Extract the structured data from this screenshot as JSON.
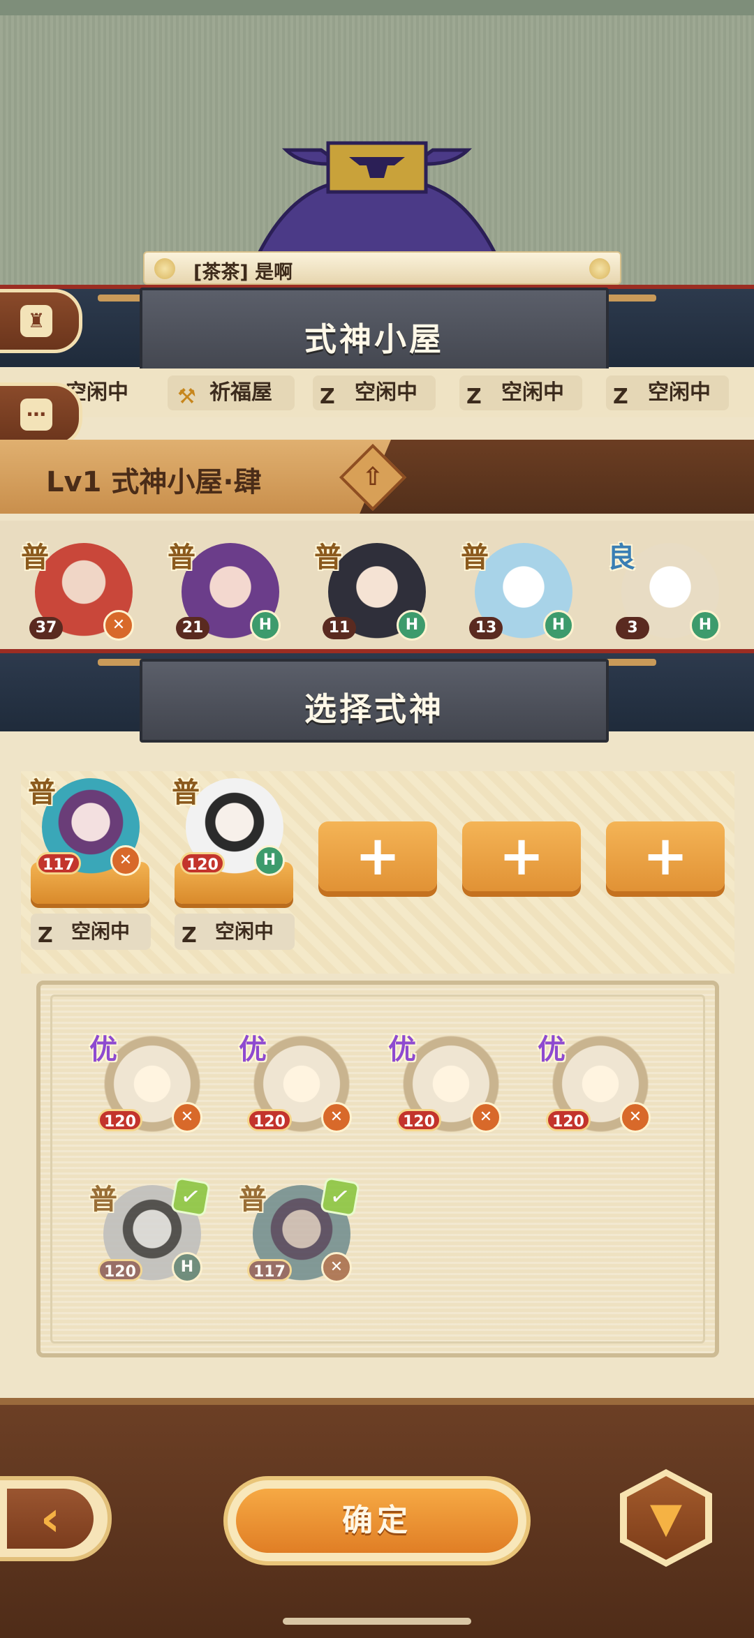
{
  "chat": {
    "speaker": "[茶茶]",
    "message": "是啊"
  },
  "house_title": "式神小屋",
  "status_row": [
    {
      "label": "空闲中",
      "icon": "zz-sleep-icon"
    },
    {
      "label": "祈福屋",
      "icon": "hammer-icon"
    },
    {
      "label": "空闲中",
      "icon": "zz-sleep-icon"
    },
    {
      "label": "空闲中",
      "icon": "zz-sleep-icon"
    },
    {
      "label": "空闲中",
      "icon": "zz-sleep-icon"
    }
  ],
  "level": {
    "text": "Lv1 式神小屋·肆",
    "upgrade_icon": "upgrade-arrow-icon"
  },
  "roster": [
    {
      "grade": "普",
      "level": "37",
      "role": "attack",
      "color": "#c9473a"
    },
    {
      "grade": "普",
      "level": "21",
      "role": "support",
      "color": "#6b3d8a"
    },
    {
      "grade": "普",
      "level": "11",
      "role": "support",
      "color": "#2f2f3a"
    },
    {
      "grade": "普",
      "level": "13",
      "role": "support",
      "color": "#a8d3e8"
    },
    {
      "grade": "良",
      "level": "3",
      "role": "support",
      "color": "#e8dcc4"
    }
  ],
  "select_title": "选择式神",
  "selected": [
    {
      "grade": "普",
      "level": "117",
      "role": "attack",
      "color": "#3aa7b8",
      "status": "空闲中"
    },
    {
      "grade": "普",
      "level": "120",
      "role": "support",
      "color": "#f2f2f2",
      "status": "空闲中"
    }
  ],
  "empty_slot_label": "+",
  "picker": [
    {
      "grade": "优",
      "level": "120",
      "role": "attack",
      "color": "#efe5d2"
    },
    {
      "grade": "优",
      "level": "120",
      "role": "attack",
      "color": "#efe5d2"
    },
    {
      "grade": "优",
      "level": "120",
      "role": "attack",
      "color": "#efe5d2"
    },
    {
      "grade": "优",
      "level": "120",
      "role": "attack",
      "color": "#efe5d2"
    },
    {
      "grade": "普",
      "level": "120",
      "role": "support",
      "color": "#bdbdbd",
      "checked": true
    },
    {
      "grade": "普",
      "level": "117",
      "role": "attack",
      "color": "#6f8c8e",
      "checked": true
    }
  ],
  "buttons": {
    "confirm": "确定",
    "back_icon": "back-arrow-icon",
    "filter_icon": "filter-funnel-icon"
  },
  "colors": {
    "accent": "#e9902f",
    "wood": "#6c3f25",
    "band": "#2d3a4d",
    "banner_red": "#9b2d22"
  }
}
